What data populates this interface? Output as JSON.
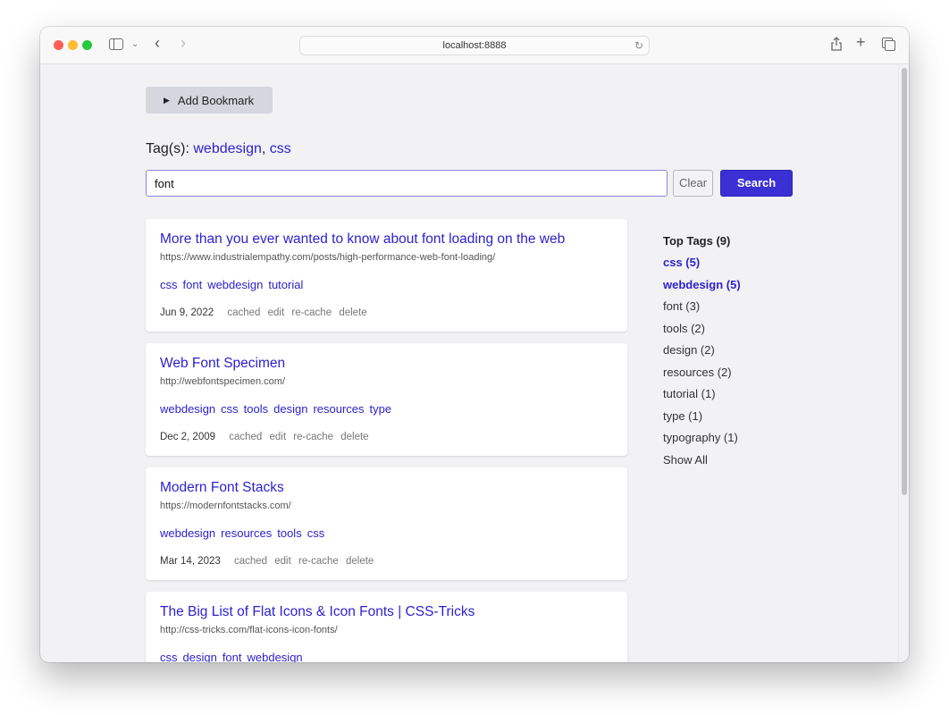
{
  "browser": {
    "url": "localhost:8888"
  },
  "toolbar": {
    "add_bookmark_label": "Add Bookmark"
  },
  "filter": {
    "label": "Tag(s):",
    "tags": [
      "webdesign",
      "css"
    ],
    "separator": ", "
  },
  "search": {
    "value": "font",
    "clear_label": "Clear",
    "search_label": "Search"
  },
  "colors": {
    "accent": "#3a30d4",
    "link": "#2e22cc"
  },
  "bookmarks": [
    {
      "title": "More than you ever wanted to know about font loading on the web",
      "url": "https://www.industrialempathy.com/posts/high-performance-web-font-loading/",
      "tags": [
        "css",
        "font",
        "webdesign",
        "tutorial"
      ],
      "date": "Jun 9, 2022",
      "actions": [
        "cached",
        "edit",
        "re-cache",
        "delete"
      ]
    },
    {
      "title": "Web Font Specimen",
      "url": "http://webfontspecimen.com/",
      "tags": [
        "webdesign",
        "css",
        "tools",
        "design",
        "resources",
        "type"
      ],
      "date": "Dec 2, 2009",
      "actions": [
        "cached",
        "edit",
        "re-cache",
        "delete"
      ]
    },
    {
      "title": "Modern Font Stacks",
      "url": "https://modernfontstacks.com/",
      "tags": [
        "webdesign",
        "resources",
        "tools",
        "css"
      ],
      "date": "Mar 14, 2023",
      "actions": [
        "cached",
        "edit",
        "re-cache",
        "delete"
      ]
    },
    {
      "title": "The Big List of Flat Icons & Icon Fonts | CSS-Tricks",
      "url": "http://css-tricks.com/flat-icons-icon-fonts/",
      "tags": [
        "css",
        "design",
        "font",
        "webdesign"
      ],
      "date": "",
      "actions": []
    }
  ],
  "top_tags": {
    "header": "Top Tags (9)",
    "items": [
      {
        "label": "css (5)",
        "active": true
      },
      {
        "label": "webdesign (5)",
        "active": true
      },
      {
        "label": "font (3)",
        "active": false
      },
      {
        "label": "tools (2)",
        "active": false
      },
      {
        "label": "design (2)",
        "active": false
      },
      {
        "label": "resources (2)",
        "active": false
      },
      {
        "label": "tutorial (1)",
        "active": false
      },
      {
        "label": "type (1)",
        "active": false
      },
      {
        "label": "typography (1)",
        "active": false
      }
    ],
    "show_all_label": "Show All"
  }
}
